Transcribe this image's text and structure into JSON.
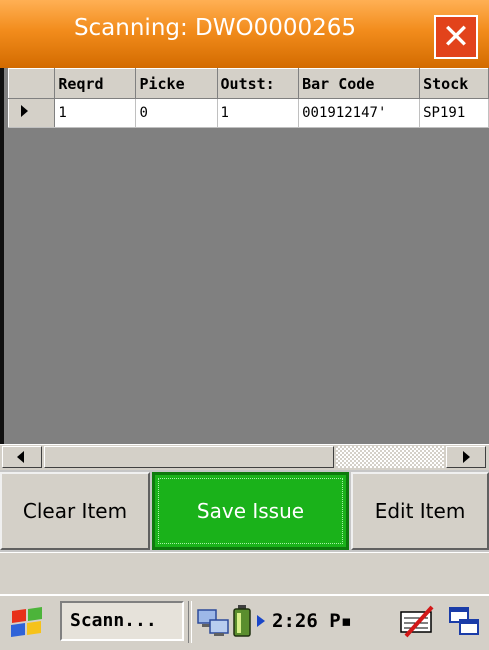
{
  "window": {
    "title": "Scanning: DWO0000265"
  },
  "grid": {
    "columns": [
      "Reqrd",
      "Picke",
      "Outst:",
      "Bar Code",
      "Stock"
    ],
    "rows": [
      {
        "current": true,
        "cells": [
          "1",
          "0",
          "1",
          "001912147'",
          "SP191"
        ]
      }
    ]
  },
  "buttons": {
    "clear_item": "Clear Item",
    "save_issue": "Save Issue",
    "edit_item": "Edit Item"
  },
  "taskbar": {
    "app_label": "Scann...",
    "clock": "2:26 P▪",
    "icons": [
      "windows-start-icon",
      "network-icon",
      "battery-icon",
      "tray-expand-arrow-icon",
      "input-panel-icon",
      "switch-windows-icon"
    ]
  },
  "colors": {
    "title_bar": "#f28c1c",
    "close_button": "#e2431b",
    "save_button": "#1ab21a",
    "grid_background": "#808080"
  }
}
